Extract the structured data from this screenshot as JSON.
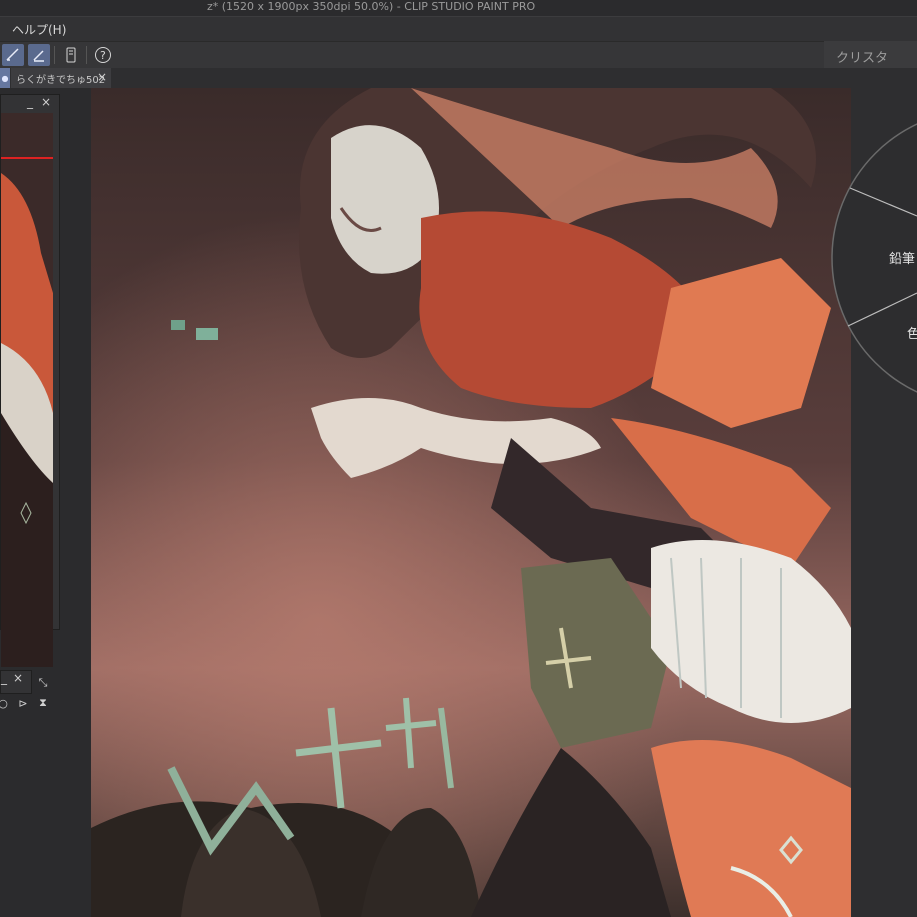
{
  "window": {
    "title": "z* (1520 x 1900px 350dpi 50.0%)  - CLIP STUDIO PAINT PRO"
  },
  "menubar": {
    "help_label": "ヘルプ(H)"
  },
  "toolbar": {
    "search_text": "クリスタ"
  },
  "tabs": [
    {
      "label": "らくがきでちゅ502",
      "close": "×"
    }
  ],
  "navigator": {
    "minimize": "_",
    "close": "×"
  },
  "panel2": {
    "minimize": "_",
    "close": "×"
  },
  "pie_menu": {
    "item1": "鉛筆",
    "item2": "色"
  },
  "colors": {
    "accent": "#5a6a8e",
    "view_frame": "#dd2222"
  }
}
